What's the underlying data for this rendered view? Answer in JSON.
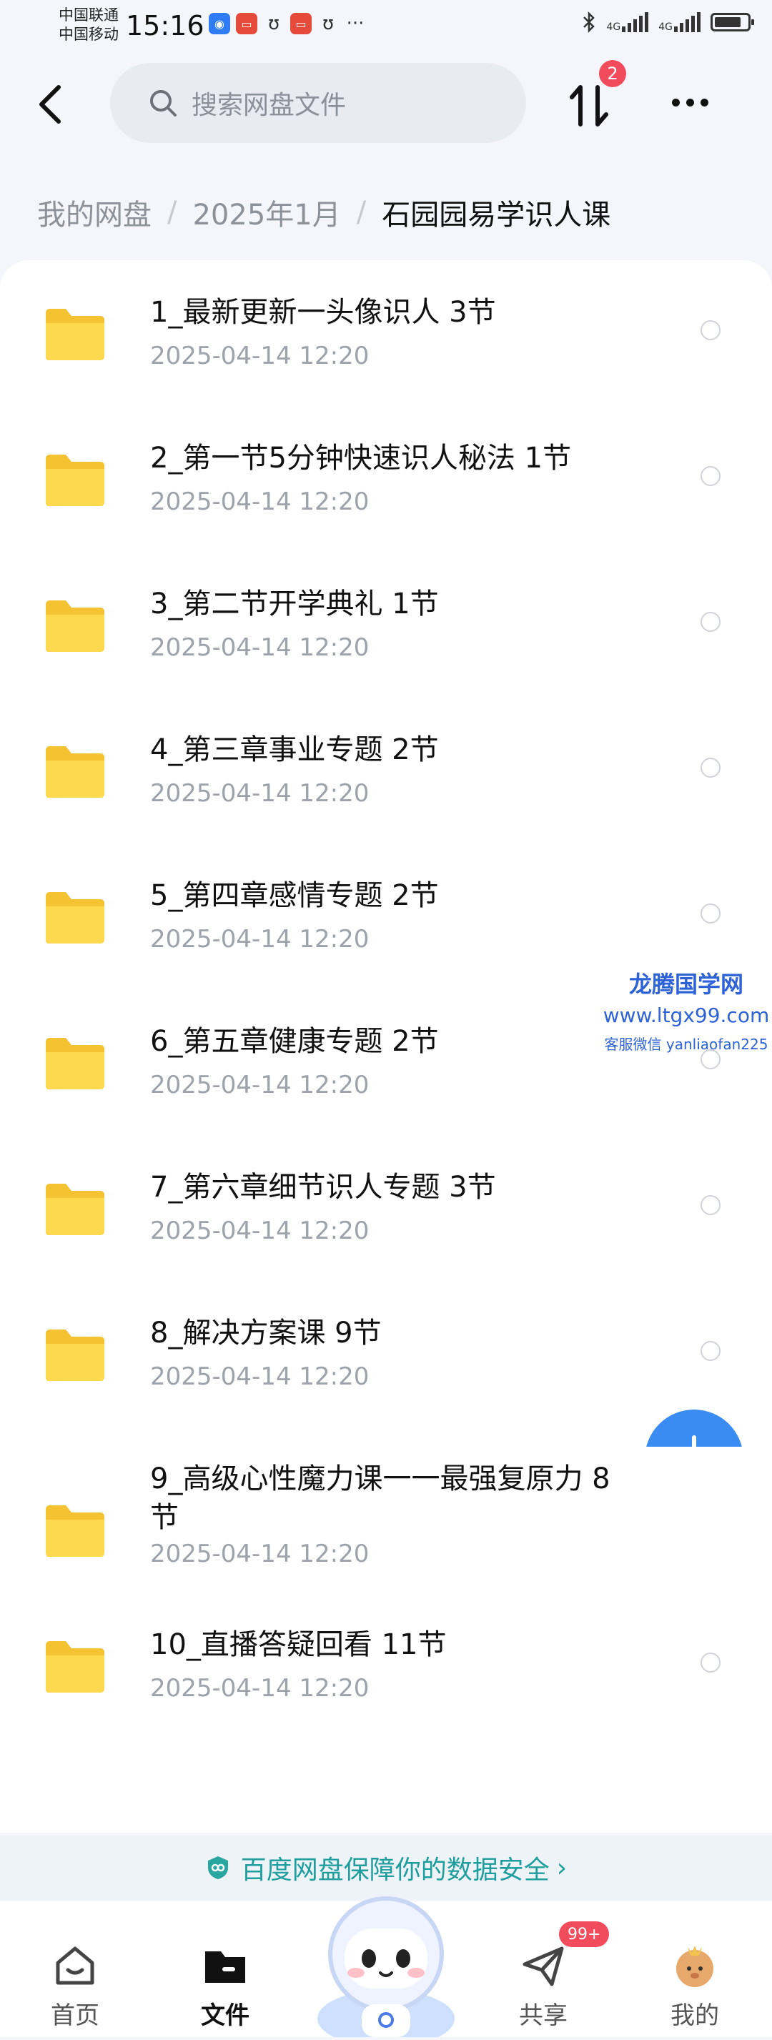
{
  "status_bar": {
    "carrier1": "中国联通",
    "carrier2": "中国移动",
    "time": "15:16",
    "net1": "4G",
    "net2": "4G"
  },
  "header": {
    "search_placeholder": "搜索网盘文件",
    "transfer_badge": "2"
  },
  "breadcrumb": {
    "items": [
      "我的网盘",
      "2025年1月",
      "石园园易学识人课"
    ]
  },
  "files": [
    {
      "name": "1_最新更新一头像识人 3节",
      "date": "2025-04-14  12:20"
    },
    {
      "name": "2_第一节5分钟快速识人秘法 1节",
      "date": "2025-04-14  12:20"
    },
    {
      "name": "3_第二节开学典礼 1节",
      "date": "2025-04-14  12:20"
    },
    {
      "name": "4_第三章事业专题 2节",
      "date": "2025-04-14  12:20"
    },
    {
      "name": "5_第四章感情专题 2节",
      "date": "2025-04-14  12:20"
    },
    {
      "name": "6_第五章健康专题 2节",
      "date": "2025-04-14  12:20"
    },
    {
      "name": "7_第六章细节识人专题 3节",
      "date": "2025-04-14  12:20"
    },
    {
      "name": "8_解决方案课 9节",
      "date": "2025-04-14  12:20"
    },
    {
      "name": "9_高级心性魔力课一一最强复原力 8节",
      "date": "2025-04-14  12:20"
    },
    {
      "name": "10_直播答疑回看 11节",
      "date": "2025-04-14  12:20"
    }
  ],
  "watermark": {
    "line1": "龙腾国学网",
    "line2": "www.ltgx99.com",
    "line3": "客服微信 yanliaofan225"
  },
  "security_banner": "百度网盘保障你的数据安全",
  "tabs": [
    {
      "label": "首页"
    },
    {
      "label": "文件"
    },
    {
      "label": "共享"
    },
    {
      "label": "我的"
    }
  ],
  "share_badge": "99+",
  "colors": {
    "accent": "#3a8cf3",
    "badge": "#f24b5c",
    "folder": "#f9cf3f",
    "security_text": "#1f9e9e"
  }
}
